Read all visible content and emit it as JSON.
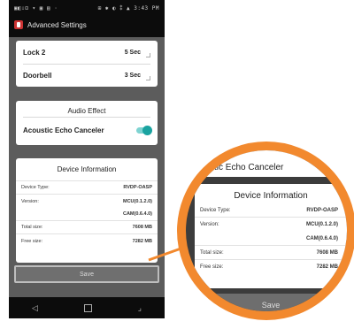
{
  "statusbar": {
    "left": "▣◧⇩⊡ ▾ ▣ ▤ ·",
    "right": "⊞ ✱ ◐ ⁑ ▲ 3:43 PM"
  },
  "appbar": {
    "title": "Advanced Settings"
  },
  "timing": {
    "rows": [
      {
        "label": "Lock 2",
        "value": "5 Sec"
      },
      {
        "label": "Doorbell",
        "value": "3 Sec"
      }
    ]
  },
  "audio": {
    "title": "Audio Effect",
    "aec_label": "Acoustic Echo Canceler",
    "aec_enabled": true
  },
  "device": {
    "title": "Device Information",
    "rows": [
      {
        "label": "Device Type:",
        "value": "RVDP-OASP"
      },
      {
        "label": "Version:",
        "value": "MCU(0.1.2.0)"
      },
      {
        "label": "",
        "value": "CAM(0.6.4.0)"
      },
      {
        "label": "Total size:",
        "value": "7608 MB"
      },
      {
        "label": "Free size:",
        "value": "7282 MB"
      }
    ]
  },
  "save_label": "Save",
  "magnifier": {
    "top_text": "tic Echo Canceler",
    "title": "Device Information",
    "rows": [
      {
        "label": "Device Type:",
        "value": "RVDP-OASP"
      },
      {
        "label": "Version:",
        "value": "MCU(0.1.2.0)"
      },
      {
        "label": "",
        "value": "CAM(0.6.4.0)"
      },
      {
        "label": "Total size:",
        "value": "7608 MB"
      },
      {
        "label": "Free size:",
        "value": "7282 MB"
      }
    ],
    "save_label": "Save"
  },
  "colors": {
    "accent": "#1aa3a0",
    "magnifier_ring": "#f2892e"
  },
  "icons": {
    "back": "back-triangle-icon",
    "home": "home-square-icon",
    "recents": "recents-icon"
  }
}
